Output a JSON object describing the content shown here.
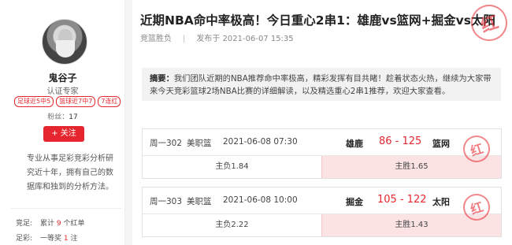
{
  "author": {
    "name": "鬼谷子",
    "title": "认证专家",
    "tags": [
      "足球近5中5",
      "篮球近7中7",
      "7连红"
    ],
    "fans_label": "粉丝：",
    "fans": "17",
    "follow_label": "+ 关注",
    "bio": "专业从事足彩竞彩分析研究近十年，拥有自己的数据库和独到的分析方法。",
    "stats": [
      {
        "key": "竞足:",
        "pre": "累计 ",
        "num": "9",
        "post": " 个红单"
      },
      {
        "key": "足彩:",
        "pre": "一等奖 ",
        "num": "1",
        "post": " 注"
      }
    ]
  },
  "article": {
    "title": "近期NBA命中率极高！今日重心2串1：雄鹿vs篮网+掘金vs太阳",
    "category": "竞篮胜负",
    "separator": "|",
    "published": "发布于 2021-06-07 15:35",
    "stamp": "红",
    "summary_label": "摘要：",
    "summary": "我们团队近期的NBA推荐命中率极高，精彩发挥有目共睹！趁着状态火热，继续为大家带来今天竞彩篮球2场NBA比赛的详细解读，以及精选重心2串1推荐，欢迎大家查看。"
  },
  "matches": [
    {
      "code": "周一302",
      "league": "美职篮",
      "time": "2021-06-08 07:30",
      "home": "雄鹿",
      "score": "86 - 125",
      "away": "篮网",
      "options": [
        {
          "label": "主负1.84",
          "hit": false
        },
        {
          "label": "主胜1.65",
          "hit": true
        }
      ],
      "stamp": "红"
    },
    {
      "code": "周一303",
      "league": "美职篮",
      "time": "2021-06-08 10:00",
      "home": "掘金",
      "score": "105 - 122",
      "away": "太阳",
      "options": [
        {
          "label": "主负2.22",
          "hit": false
        },
        {
          "label": "主胜1.43",
          "hit": true
        }
      ],
      "stamp": "红"
    }
  ]
}
